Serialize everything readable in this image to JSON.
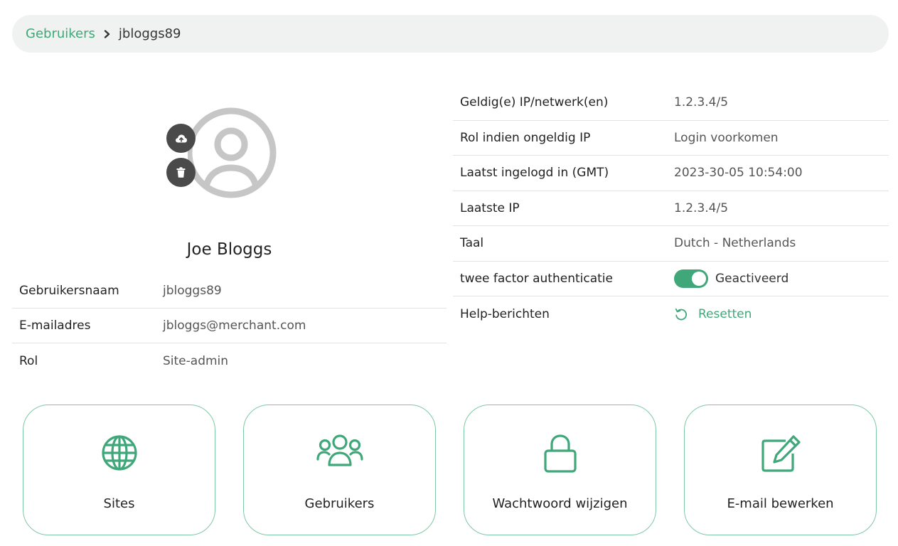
{
  "breadcrumb": {
    "parent": "Gebruikers",
    "current": "jbloggs89"
  },
  "profile": {
    "name": "Joe Bloggs",
    "fields": [
      {
        "label": "Gebruikersnaam",
        "value": "jbloggs89"
      },
      {
        "label": "E-mailadres",
        "value": "jbloggs@merchant.com"
      },
      {
        "label": "Rol",
        "value": "Site-admin"
      }
    ]
  },
  "details": {
    "rows": [
      {
        "label": "Geldig(e) IP/netwerk(en)",
        "value": "1.2.3.4/5"
      },
      {
        "label": "Rol indien ongeldig IP",
        "value": "Login voorkomen"
      },
      {
        "label": "Laatst ingelogd in (GMT)",
        "value": "2023-30-05 10:54:00"
      },
      {
        "label": "Laatste IP",
        "value": "1.2.3.4/5"
      },
      {
        "label": "Taal",
        "value": "Dutch - Netherlands"
      }
    ],
    "two_factor": {
      "label": "twee factor authenticatie",
      "status": "Geactiveerd",
      "enabled": true
    },
    "help": {
      "label": "Help-berichten",
      "action": "Resetten"
    }
  },
  "tiles": [
    {
      "label": "Sites",
      "icon": "globe-icon"
    },
    {
      "label": "Gebruikers",
      "icon": "users-icon"
    },
    {
      "label": "Wachtwoord wijzigen",
      "icon": "lock-icon"
    },
    {
      "label": "E-mail bewerken",
      "icon": "edit-icon"
    }
  ],
  "colors": {
    "accent": "#3fa779",
    "tile_border": "#7fc8a5",
    "breadcrumb_bg": "#f0f1f1",
    "avatar_button": "#4a4a4a"
  }
}
